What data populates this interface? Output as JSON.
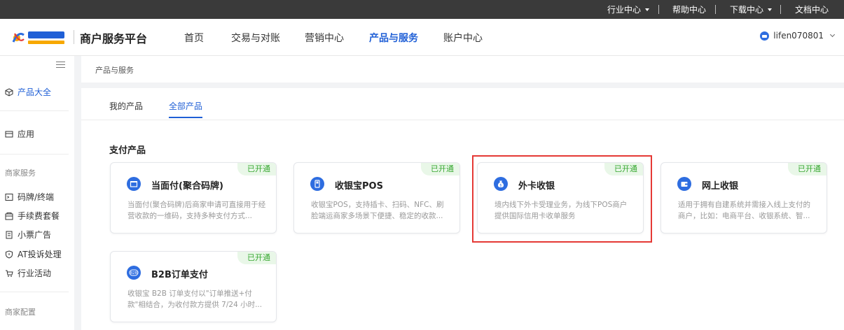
{
  "topbar": {
    "items": [
      "行业中心",
      "帮助中心",
      "下载中心",
      "文档中心"
    ]
  },
  "header": {
    "brand_title": "商户服务平台",
    "nav": [
      "首页",
      "交易与对账",
      "营销中心",
      "产品与服务",
      "账户中心"
    ],
    "active_nav": "产品与服务",
    "username": "lifen070801"
  },
  "sidebar": {
    "active_item": "产品大全",
    "top_items": [
      "产品大全",
      "应用"
    ],
    "group_merchant_service": "商家服务",
    "merchant_items": [
      "码牌/终端",
      "手续费套餐",
      "小票广告",
      "AT投诉处理",
      "行业活动"
    ],
    "group_merchant_config": "商家配置"
  },
  "breadcrumb": "产品与服务",
  "tabs": [
    "我的产品",
    "全部产品"
  ],
  "active_tab": "全部产品",
  "section_title": "支付产品",
  "cards": [
    {
      "title": "当面付(聚合码牌)",
      "badge": "已开通",
      "desc": "当面付(聚合码牌)后商家申请可直接用于经营收款的一维码，支持多种支付方式...",
      "icon": "store-icon"
    },
    {
      "title": "收银宝POS",
      "badge": "已开通",
      "desc": "收银宝POS，支持插卡、扫码、NFC、刷脸端运商家多场景下便捷、稳定的收款...",
      "icon": "pos-icon"
    },
    {
      "title": "外卡收银",
      "badge": "已开通",
      "desc": "境内线下外卡受理业务，为线下POS商户提供国际信用卡收单服务",
      "icon": "money-bag-icon"
    },
    {
      "title": "网上收银",
      "badge": "已开通",
      "desc": "适用于拥有自建系统并需接入线上支付的商户，比如：电商平台、收银系统、智...",
      "icon": "wallet-icon"
    },
    {
      "title": "B2B订单支付",
      "badge": "已开通",
      "desc": "收银宝 B2B 订单支付以\"订单推送+付款\"相结合，为收付款方提供 7/24 小时...",
      "icon": "b2b-icon"
    }
  ],
  "colors": {
    "accent": "#1f5fd6",
    "badge_text": "#38a832",
    "badge_bg": "#e9f7e8",
    "highlight": "#e53935",
    "topbar_bg": "#3a3a3a"
  }
}
